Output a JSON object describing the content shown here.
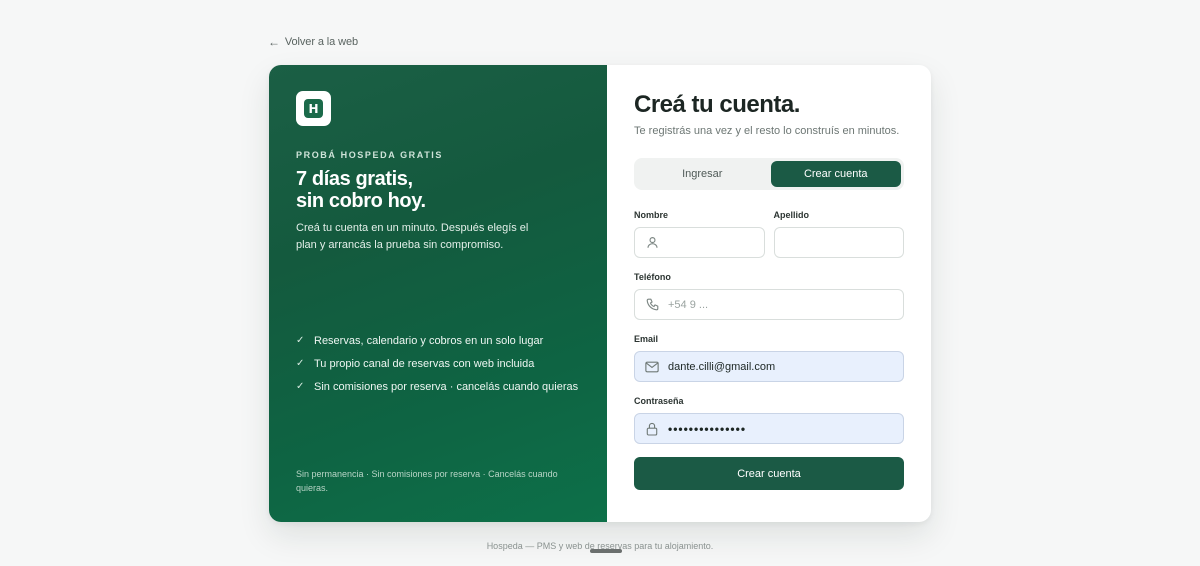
{
  "nav": {
    "back_arrow": "←",
    "back_label": "Volver a la web"
  },
  "promo": {
    "logo_letter": "H",
    "eyebrow": "PROBÁ HOSPEDA GRATIS",
    "headline": "7 días gratis,\nsin cobro hoy.",
    "description": "Creá tu cuenta en un minuto. Después elegís el plan y arrancás la prueba sin compromiso.",
    "features": [
      "Reservas, calendario y cobros en un solo lugar",
      "Tu propio canal de reservas con web incluida",
      "Sin comisiones por reserva · cancelás cuando quieras"
    ],
    "check_glyph": "✓",
    "fine_print": "Sin permanencia · Sin comisiones por reserva · Cancelás cuando quieras."
  },
  "form": {
    "title": "Creá tu cuenta.",
    "subtitle": "Te registrás una vez y el resto lo construís en minutos.",
    "tabs": [
      {
        "label": "Ingresar",
        "active": false
      },
      {
        "label": "Crear cuenta",
        "active": true
      }
    ],
    "first_name": {
      "label": "Nombre",
      "value": "",
      "icon": "user-icon"
    },
    "last_name": {
      "label": "Apellido",
      "value": ""
    },
    "phone": {
      "label": "Teléfono",
      "placeholder": "+54 9 ...",
      "icon": "phone-icon"
    },
    "email": {
      "label": "Email",
      "value": "dante.cilli@gmail.com",
      "icon": "mail-icon"
    },
    "password": {
      "label": "Contraseña",
      "masked_value": "•••••••••••••••",
      "icon": "lock-icon"
    },
    "submit_label": "Crear cuenta"
  },
  "footer": {
    "text": "Hospeda — PMS y web de reservas para tu alojamiento."
  },
  "colors": {
    "brand": "#1b5a45",
    "autofill": "#e8f0fd"
  }
}
